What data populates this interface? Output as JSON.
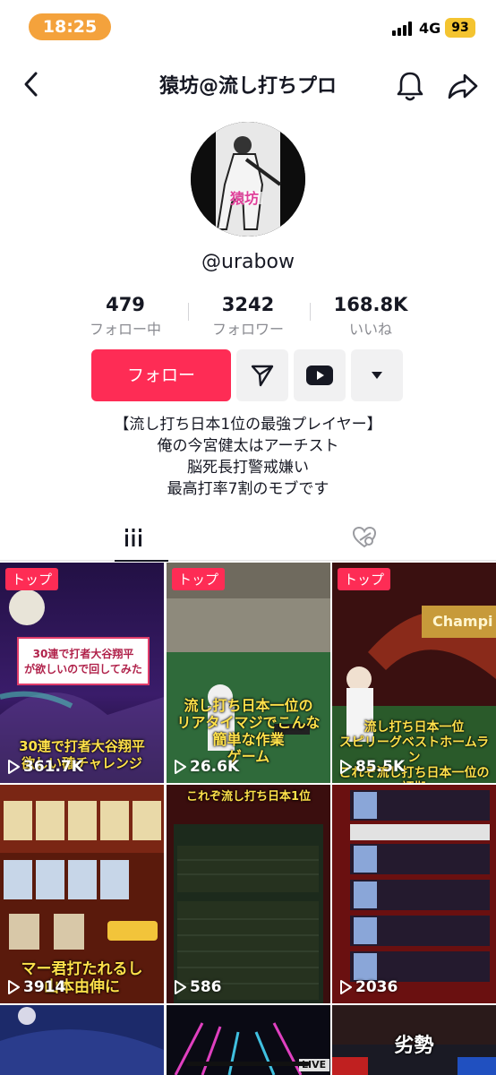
{
  "status": {
    "time": "18:25",
    "network": "4G",
    "battery": "93"
  },
  "header": {
    "title": "猿坊@流し打ちプロ"
  },
  "profile": {
    "handle": "@urabow",
    "stats": [
      {
        "value": "479",
        "label": "フォロー中"
      },
      {
        "value": "3242",
        "label": "フォロワー"
      },
      {
        "value": "168.8K",
        "label": "いいね"
      }
    ],
    "follow_label": "フォロー",
    "bio": [
      "【流し打ち日本1位の最強プレイヤー】",
      "俺の今宮健太はアーチスト",
      "脳死長打警戒嫌い",
      "最高打率7割のモブです"
    ],
    "avatar_text": "猿坊"
  },
  "videos": [
    {
      "badge": "トップ",
      "views": "361.7K",
      "caption": "30連で打者大谷翔平が欲しいので回してみた"
    },
    {
      "badge": "トップ",
      "views": "26.6K",
      "caption": "流し打ち日本一位のリアタイマジでこんな簡単な作業ゲーム"
    },
    {
      "badge": "トップ",
      "views": "85.5K",
      "caption": "流し打ち日本一位スピリーグベストホームランこれぞ流し打ち日本一位の証拠"
    },
    {
      "badge": "",
      "views": "3914",
      "caption": "マー君打たれるし山本由伸に"
    },
    {
      "badge": "",
      "views": "586",
      "caption": "これぞ流し打ち日本1位"
    },
    {
      "badge": "",
      "views": "2036",
      "caption": ""
    },
    {
      "badge": "",
      "views": "",
      "caption": ""
    },
    {
      "badge": "",
      "views": "",
      "caption": "LIVE"
    },
    {
      "badge": "",
      "views": "",
      "caption": "劣勢"
    }
  ],
  "colors": {
    "accent": "#fe2c55",
    "status_pill": "#f4a23c",
    "battery": "#f4c430"
  }
}
